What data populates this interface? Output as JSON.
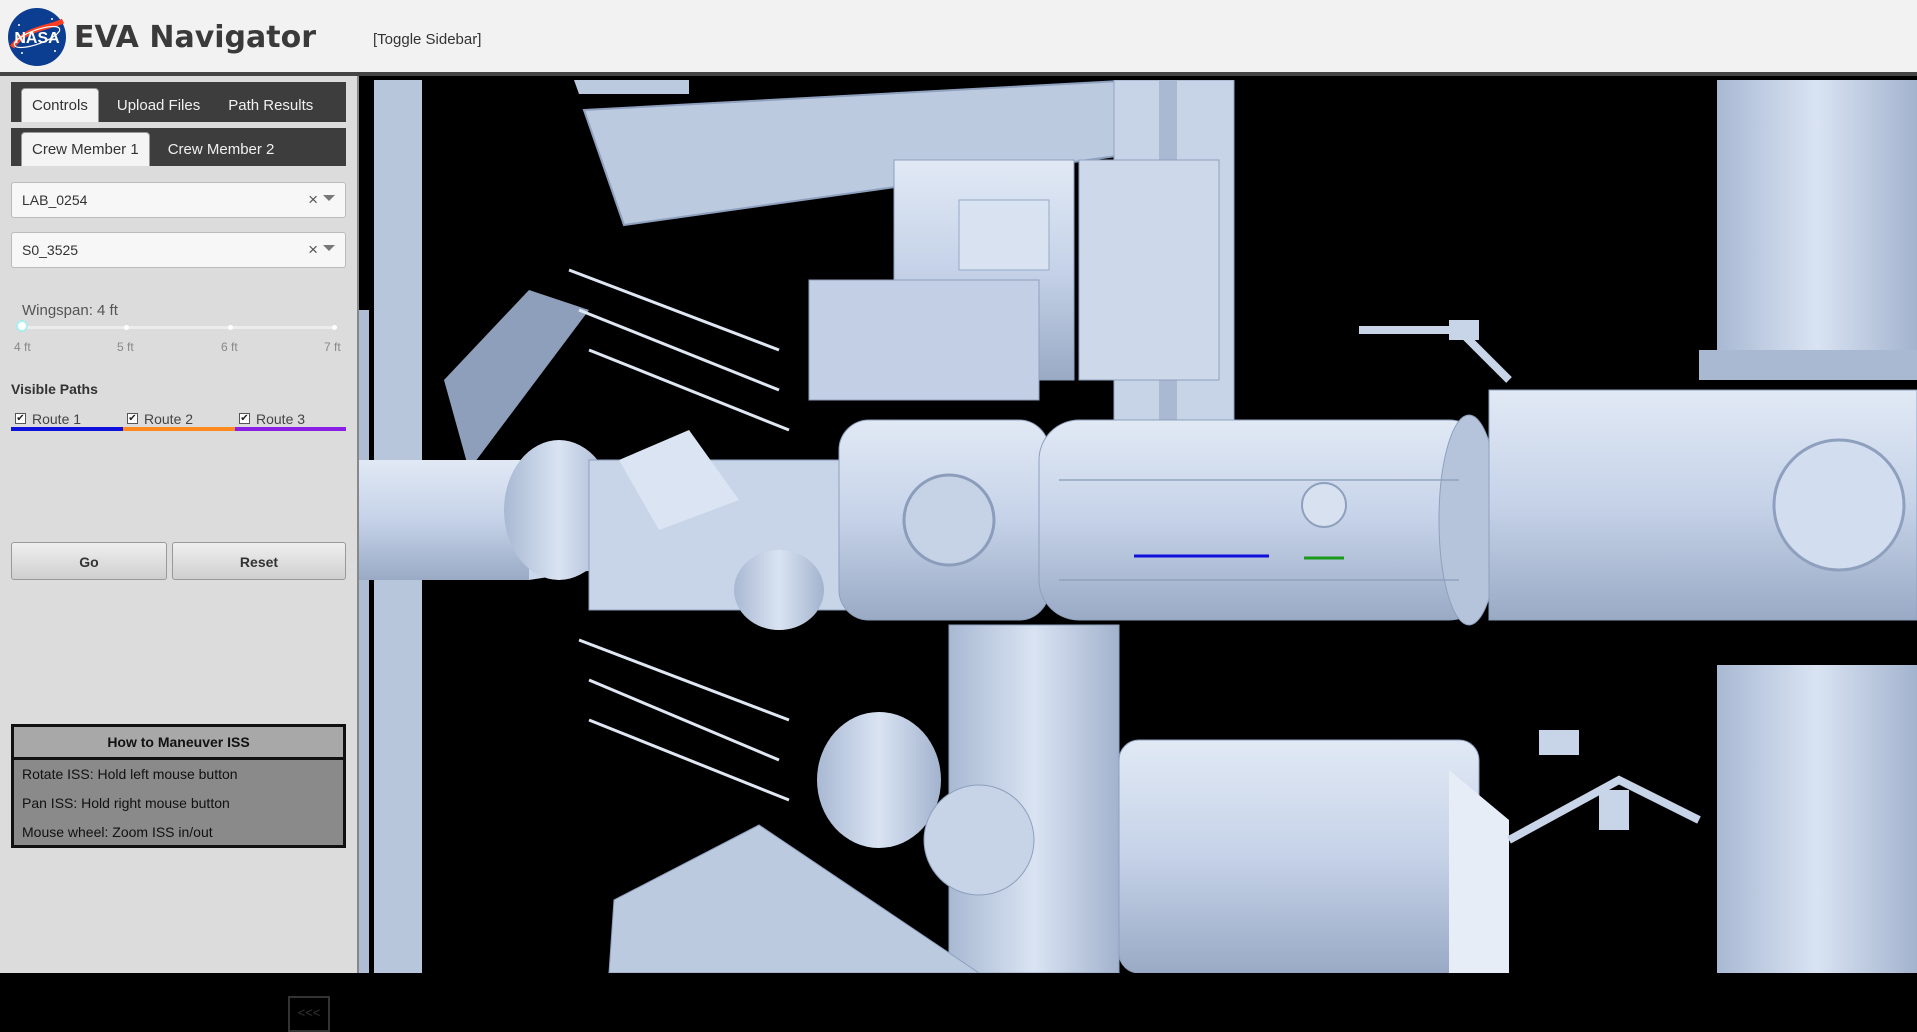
{
  "header": {
    "logo_text": "NASA",
    "title": "EVA Navigator",
    "toggle_sidebar": "[Toggle Sidebar]"
  },
  "tabs": [
    {
      "label": "Controls",
      "active": true
    },
    {
      "label": "Upload Files",
      "active": false
    },
    {
      "label": "Path Results",
      "active": false
    }
  ],
  "crew_tabs": [
    {
      "label": "Crew Member 1",
      "active": true
    },
    {
      "label": "Crew Member 2",
      "active": false
    }
  ],
  "start_select": {
    "value": "LAB_0254",
    "clear": "×"
  },
  "end_select": {
    "value": "S0_3525",
    "clear": "×"
  },
  "wingspan": {
    "label": "Wingspan: 4 ft",
    "value_ft": 4,
    "ticks": [
      "4 ft",
      "5 ft",
      "6 ft",
      "7 ft"
    ]
  },
  "visible_paths": {
    "title": "Visible Paths",
    "routes": [
      {
        "label": "Route 1",
        "checked": true,
        "color": "#1010dd"
      },
      {
        "label": "Route 2",
        "checked": true,
        "color": "#ff8a1f"
      },
      {
        "label": "Route 3",
        "checked": true,
        "color": "#8a1fe6"
      }
    ]
  },
  "buttons": {
    "go": "Go",
    "reset": "Reset"
  },
  "howto": {
    "title": "How to Maneuver ISS",
    "lines": [
      "Rotate ISS: Hold left mouse button",
      "Pan ISS: Hold right mouse button",
      "Mouse wheel: Zoom ISS in/out"
    ]
  },
  "collapse_label": "<<<",
  "colors": {
    "station": "#c5d2e8",
    "station_shade": "#9fb1cc",
    "path_blue": "#1010dd",
    "path_green": "#1a9a1a"
  }
}
